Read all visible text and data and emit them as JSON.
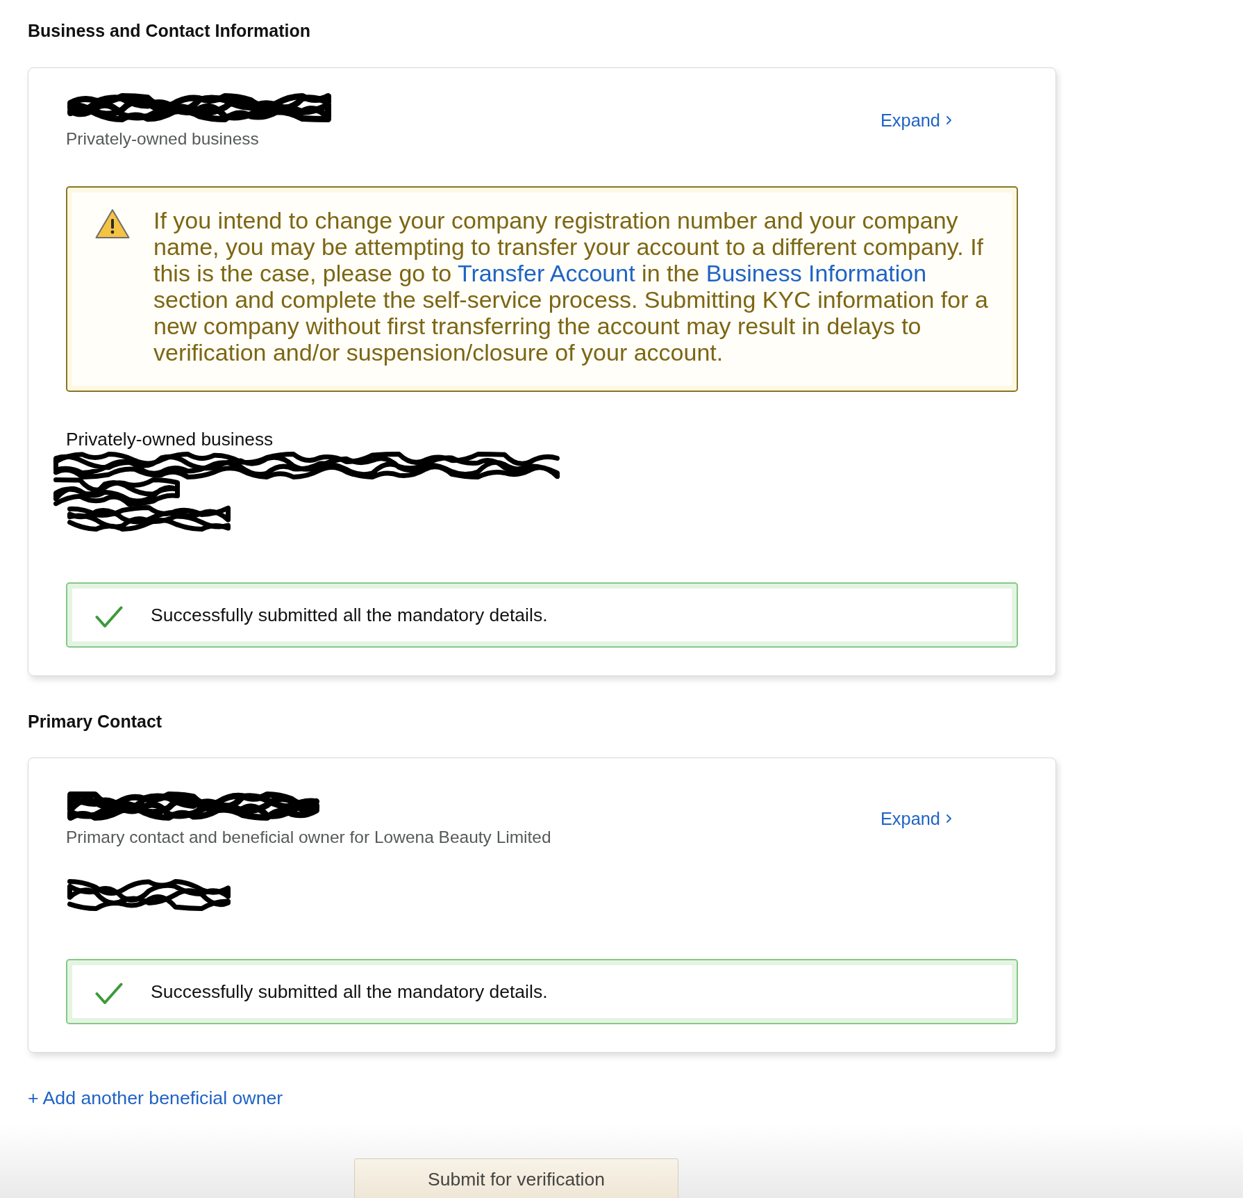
{
  "sections": [
    {
      "heading": "Business and Contact Information",
      "card": {
        "title": {
          "kind": "redacted"
        },
        "subtitle": "Privately-owned business",
        "expand_link": "Expand",
        "alert": {
          "kind": "warning",
          "segments": [
            {
              "kind": "text",
              "text": "If you intend to change your company registration number and your company name, you may be attempting to transfer your account to a different company. If this is the case, please go to "
            },
            {
              "kind": "link",
              "text": "Transfer Account"
            },
            {
              "kind": "text",
              "text": " in the "
            },
            {
              "kind": "link",
              "text": "Business Information"
            },
            {
              "kind": "text",
              "text": " section and complete the self-service process. Submitting KYC information for a new company without first transferring the account may result in delays to verification and/or suspension/closure of your account."
            }
          ]
        },
        "details": [
          {
            "kind": "text",
            "text": "Privately-owned business"
          },
          {
            "kind": "redacted"
          },
          {
            "kind": "redacted"
          },
          {
            "kind": "redacted"
          }
        ],
        "status": {
          "kind": "success",
          "text": "Successfully submitted all the mandatory details."
        }
      }
    },
    {
      "heading": "Primary Contact",
      "card": {
        "title": {
          "kind": "redacted"
        },
        "subtitle": "Primary contact and beneficial owner for Lowena Beauty Limited",
        "expand_link": "Expand",
        "details": [
          {
            "kind": "redacted"
          }
        ],
        "status": {
          "kind": "success",
          "text": "Successfully submitted all the mandatory details."
        }
      }
    }
  ],
  "add_owner_link": "+ Add another beneficial owner",
  "submit_button": "Submit for verification"
}
